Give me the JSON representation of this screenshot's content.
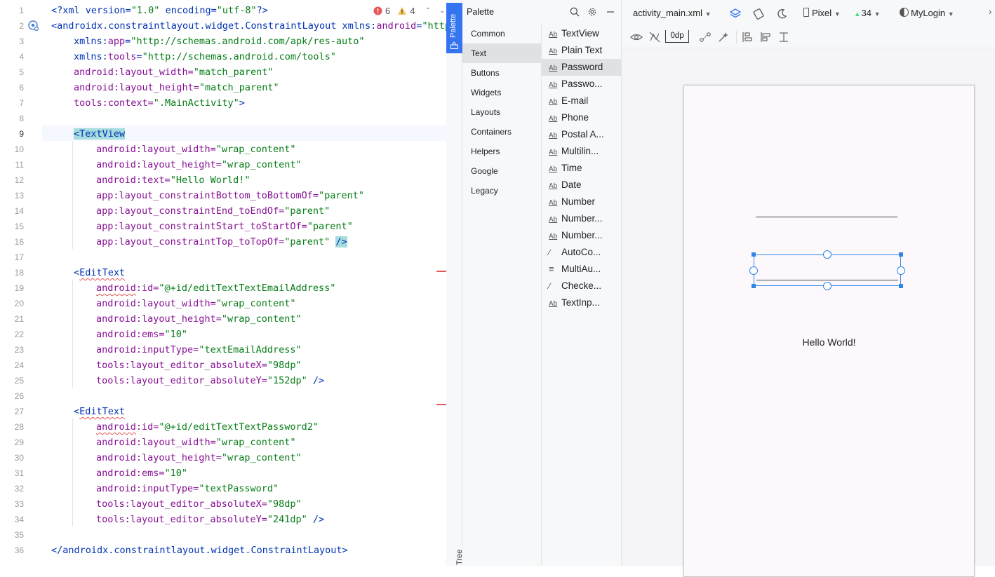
{
  "editor": {
    "inspections": {
      "errors": "6",
      "warnings": "4"
    },
    "lines": [
      {
        "n": "1"
      },
      {
        "n": "2"
      },
      {
        "n": "3"
      },
      {
        "n": "4"
      },
      {
        "n": "5"
      },
      {
        "n": "6"
      },
      {
        "n": "7"
      },
      {
        "n": "8"
      },
      {
        "n": "9"
      },
      {
        "n": "10"
      },
      {
        "n": "11"
      },
      {
        "n": "12"
      },
      {
        "n": "13"
      },
      {
        "n": "14"
      },
      {
        "n": "15"
      },
      {
        "n": "16"
      },
      {
        "n": "17"
      },
      {
        "n": "18"
      },
      {
        "n": "19"
      },
      {
        "n": "20"
      },
      {
        "n": "21"
      },
      {
        "n": "22"
      },
      {
        "n": "23"
      },
      {
        "n": "24"
      },
      {
        "n": "25"
      },
      {
        "n": "26"
      },
      {
        "n": "27"
      },
      {
        "n": "28"
      },
      {
        "n": "29"
      },
      {
        "n": "30"
      },
      {
        "n": "31"
      },
      {
        "n": "32"
      },
      {
        "n": "33"
      },
      {
        "n": "34"
      },
      {
        "n": "35"
      },
      {
        "n": "36"
      }
    ],
    "code": {
      "l1a": "<?xml version=",
      "l1b": "\"1.0\"",
      "l1c": " encoding=",
      "l1d": "\"utf-8\"",
      "l1e": "?>",
      "l2a": "<",
      "l2b": "androidx.constraintlayout.widget.ConstraintLayout",
      "l2c": " xmlns:",
      "l2d": "android",
      "l2e": "=",
      "l2f": "\"http",
      "l3a": "xmlns:",
      "l3b": "app",
      "l3c": "=",
      "l3d": "\"http://schemas.android.com/apk/res-auto\"",
      "l4a": "xmlns:",
      "l4b": "tools",
      "l4c": "=",
      "l4d": "\"http://schemas.android.com/tools\"",
      "l5a": "android",
      "l5b": ":layout_width=",
      "l5c": "\"match_parent\"",
      "l6a": "android",
      "l6b": ":layout_height=",
      "l6c": "\"match_parent\"",
      "l7a": "tools",
      "l7b": ":context=",
      "l7c": "\".MainActivity\"",
      "l7d": ">",
      "l9a": "<",
      "l9b": "TextView",
      "l10a": "android",
      "l10b": ":layout_width=",
      "l10c": "\"wrap_content\"",
      "l11a": "android",
      "l11b": ":layout_height=",
      "l11c": "\"wrap_content\"",
      "l12a": "android",
      "l12b": ":text=",
      "l12c": "\"Hello World!\"",
      "l13a": "app",
      "l13b": ":layout_constraintBottom_toBottomOf=",
      "l13c": "\"parent\"",
      "l14a": "app",
      "l14b": ":layout_constraintEnd_toEndOf=",
      "l14c": "\"parent\"",
      "l15a": "app",
      "l15b": ":layout_constraintStart_toStartOf=",
      "l15c": "\"parent\"",
      "l16a": "app",
      "l16b": ":layout_constraintTop_toTopOf=",
      "l16c": "\"parent\"",
      "l16d": "/>",
      "l18a": "<",
      "l18b": "EditText",
      "l19a": "android",
      "l19b": ":id=",
      "l19c": "\"@+id/editTextTextEmailAddress\"",
      "l20a": "android",
      "l20b": ":layout_width=",
      "l20c": "\"wrap_content\"",
      "l21a": "android",
      "l21b": ":layout_height=",
      "l21c": "\"wrap_content\"",
      "l22a": "android",
      "l22b": ":ems=",
      "l22c": "\"10\"",
      "l23a": "android",
      "l23b": ":inputType=",
      "l23c": "\"textEmailAddress\"",
      "l24a": "tools",
      "l24b": ":layout_editor_absoluteX=",
      "l24c": "\"98dp\"",
      "l25a": "tools",
      "l25b": ":layout_editor_absoluteY=",
      "l25c": "\"152dp\"",
      "l25d": " />",
      "l27a": "<",
      "l27b": "EditText",
      "l28a": "android",
      "l28b": ":id=",
      "l28c": "\"@+id/editTextTextPassword2\"",
      "l29a": "android",
      "l29b": ":layout_width=",
      "l29c": "\"wrap_content\"",
      "l30a": "android",
      "l30b": ":layout_height=",
      "l30c": "\"wrap_content\"",
      "l31a": "android",
      "l31b": ":ems=",
      "l31c": "\"10\"",
      "l32a": "android",
      "l32b": ":inputType=",
      "l32c": "\"textPassword\"",
      "l33a": "tools",
      "l33b": ":layout_editor_absoluteX=",
      "l33c": "\"98dp\"",
      "l34a": "tools",
      "l34b": ":layout_editor_absoluteY=",
      "l34c": "\"241dp\"",
      "l34d": " />",
      "l36a": "</",
      "l36b": "androidx.constraintlayout.widget.ConstraintLayout",
      "l36c": ">"
    }
  },
  "strip": {
    "palette_tab": "Palette",
    "tree_tab": "Tree"
  },
  "palette": {
    "title": "Palette",
    "categories": [
      "Common",
      "Text",
      "Buttons",
      "Widgets",
      "Layouts",
      "Containers",
      "Helpers",
      "Google",
      "Legacy"
    ],
    "selected_category": "Text",
    "items": [
      {
        "label": "TextView",
        "icon": "Ab"
      },
      {
        "label": "Plain Text",
        "icon": "Ab"
      },
      {
        "label": "Password",
        "icon": "Ab"
      },
      {
        "label": "Passwo...",
        "icon": "Ab"
      },
      {
        "label": "E-mail",
        "icon": "Ab"
      },
      {
        "label": "Phone",
        "icon": "Ab"
      },
      {
        "label": "Postal A...",
        "icon": "Ab"
      },
      {
        "label": "Multilin...",
        "icon": "Ab"
      },
      {
        "label": "Time",
        "icon": "Ab"
      },
      {
        "label": "Date",
        "icon": "Ab"
      },
      {
        "label": "Number",
        "icon": "Ab"
      },
      {
        "label": "Number...",
        "icon": "Ab"
      },
      {
        "label": "Number...",
        "icon": "Ab"
      },
      {
        "label": "AutoCo...",
        "icon": "autocomplete-icon"
      },
      {
        "label": "MultiAu...",
        "icon": "multiautocomplete-icon"
      },
      {
        "label": "Checke...",
        "icon": "checked-textview-icon"
      },
      {
        "label": "TextInp...",
        "icon": "Ab"
      }
    ],
    "selected_item": "Password"
  },
  "design": {
    "file_name": "activity_main.xml",
    "device": "Pixel",
    "api": "34",
    "theme": "MyLogin",
    "margin": "0dp",
    "preview_text": "Hello World!"
  },
  "colors": {
    "accent": "#3574f0",
    "selection": "#2f86e8"
  }
}
